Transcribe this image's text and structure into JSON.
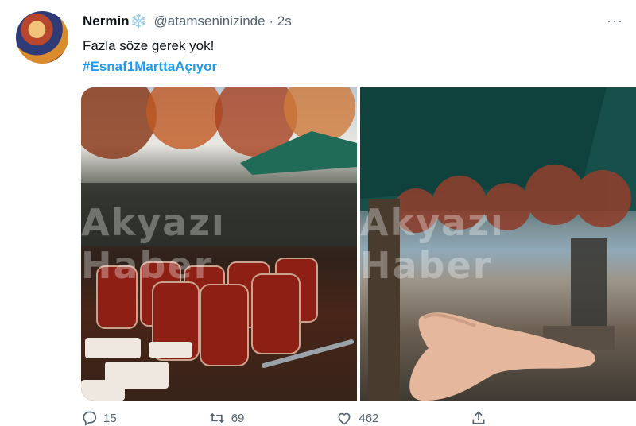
{
  "tweet": {
    "author_name": "Nermin",
    "name_emoji": "❄️",
    "handle": "@atamseninizinde",
    "separator": "·",
    "time": "2s",
    "text": "Fazla söze gerek yok!",
    "hashtag": "#Esnaf1MarttaAçıyor"
  },
  "media": {
    "watermark": "Akyazı Haber"
  },
  "actions": {
    "reply_count": "15",
    "retweet_count": "69",
    "like_count": "462"
  },
  "icons": {
    "more": "more-icon",
    "reply": "reply-icon",
    "retweet": "retweet-icon",
    "like": "like-icon",
    "share": "share-icon"
  }
}
